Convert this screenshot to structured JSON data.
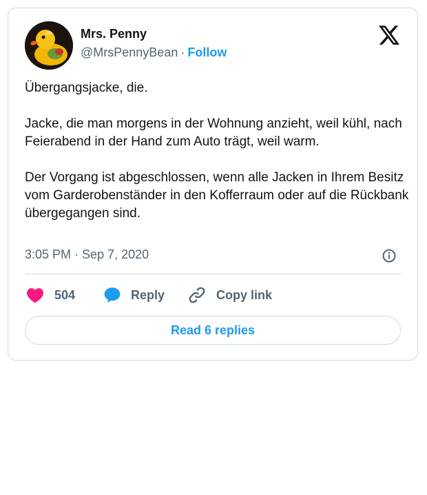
{
  "author": {
    "name": "Mrs. Penny",
    "handle": "@MrsPennyBean",
    "separator": "·",
    "follow_label": "Follow",
    "avatar_icon": "rubber-duck-avatar"
  },
  "brand": {
    "logo_icon": "x-logo-icon"
  },
  "tweet": {
    "paragraphs": [
      "Übergangsjacke, die.",
      "Jacke, die man morgens in der Wohnung anzieht, weil kühl, nach Feierabend in der Hand zum Auto trägt, weil warm.",
      "Der Vorgang ist abgeschlossen, wenn alle Jacken in Ihrem Besitz vom Garderobenständer in den Kofferraum oder auf die Rückbank übergegangen sind."
    ],
    "timestamp": "3:05 PM · Sep 7, 2020"
  },
  "actions": {
    "like_count": "504",
    "reply_label": "Reply",
    "copy_label": "Copy link"
  },
  "footer": {
    "read_replies_label": "Read 6 replies"
  },
  "colors": {
    "accent": "#1d9bf0",
    "like": "#f91880",
    "muted": "#536471",
    "border": "#cfd9de"
  }
}
